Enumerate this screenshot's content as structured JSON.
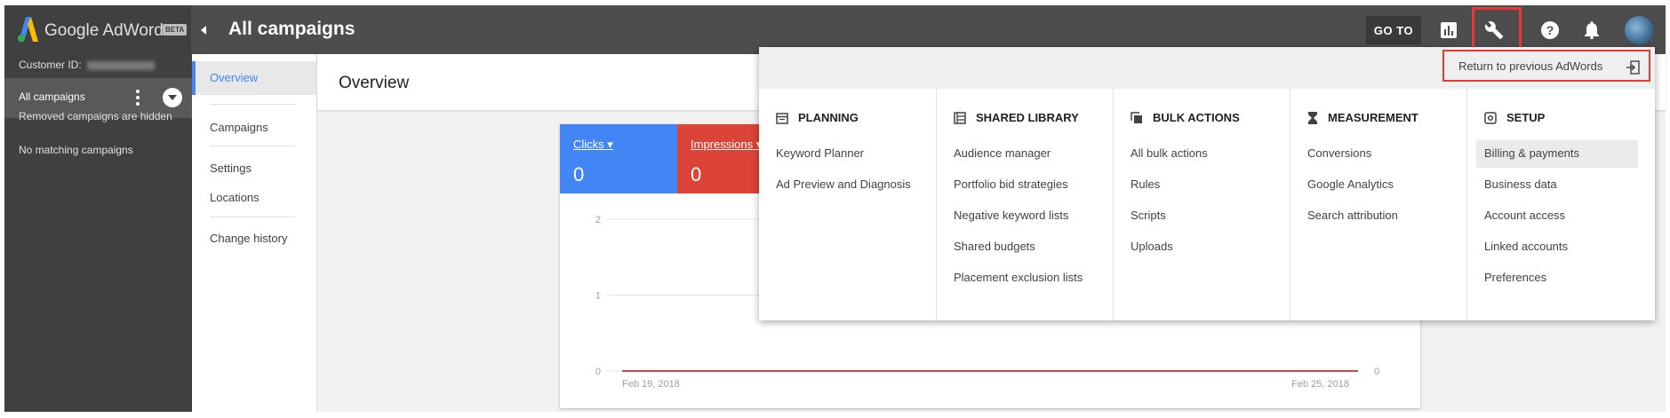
{
  "topbar": {
    "app_name": "Google AdWords",
    "beta_badge": "BETA",
    "page_title": "All campaigns",
    "goto_label": "GO TO",
    "icons": [
      "reports-icon",
      "tools-wrench-icon",
      "help-icon",
      "notifications-bell-icon",
      "avatar"
    ]
  },
  "sidebar": {
    "customer_id_label": "Customer ID:",
    "all_campaigns": "All campaigns",
    "removed_hidden": "Removed campaigns are hidden",
    "no_matching": "No matching campaigns"
  },
  "subnav": {
    "items": [
      "Overview",
      "Campaigns",
      "Settings",
      "Locations",
      "Change history"
    ],
    "active": "Overview"
  },
  "main": {
    "title": "Overview",
    "metrics": [
      {
        "label": "Clicks",
        "value": "0",
        "color": "#4285f4"
      },
      {
        "label": "Impressions",
        "value": "0",
        "color": "#db4437"
      }
    ],
    "chart": {
      "y_ticks_left": [
        "2",
        "1",
        "0"
      ],
      "y_tick_right": "0",
      "x_start": "Feb 19, 2018",
      "x_end": "Feb 25, 2018"
    }
  },
  "chart_data": {
    "type": "line",
    "x": [
      "Feb 19, 2018",
      "Feb 25, 2018"
    ],
    "series": [
      {
        "name": "Clicks",
        "values": [
          0,
          0
        ]
      }
    ],
    "ylim": [
      0,
      2
    ],
    "grid": true
  },
  "menu": {
    "return_label": "Return to previous AdWords",
    "columns": [
      {
        "heading": "PLANNING",
        "icon": "planning-icon",
        "items": [
          "Keyword Planner",
          "Ad Preview and Diagnosis"
        ]
      },
      {
        "heading": "SHARED LIBRARY",
        "icon": "shared-library-icon",
        "items": [
          "Audience manager",
          "Portfolio bid strategies",
          "Negative keyword lists",
          "Shared budgets",
          "Placement exclusion lists"
        ]
      },
      {
        "heading": "BULK ACTIONS",
        "icon": "bulk-actions-icon",
        "items": [
          "All bulk actions",
          "Rules",
          "Scripts",
          "Uploads"
        ]
      },
      {
        "heading": "MEASUREMENT",
        "icon": "measurement-hourglass-icon",
        "items": [
          "Conversions",
          "Google Analytics",
          "Search attribution"
        ]
      },
      {
        "heading": "SETUP",
        "icon": "setup-icon",
        "items": [
          "Billing & payments",
          "Business data",
          "Account access",
          "Linked accounts",
          "Preferences"
        ]
      }
    ]
  },
  "colors": {
    "accent_blue": "#4285f4",
    "accent_red": "#db4437",
    "highlight_red": "#e53935"
  }
}
